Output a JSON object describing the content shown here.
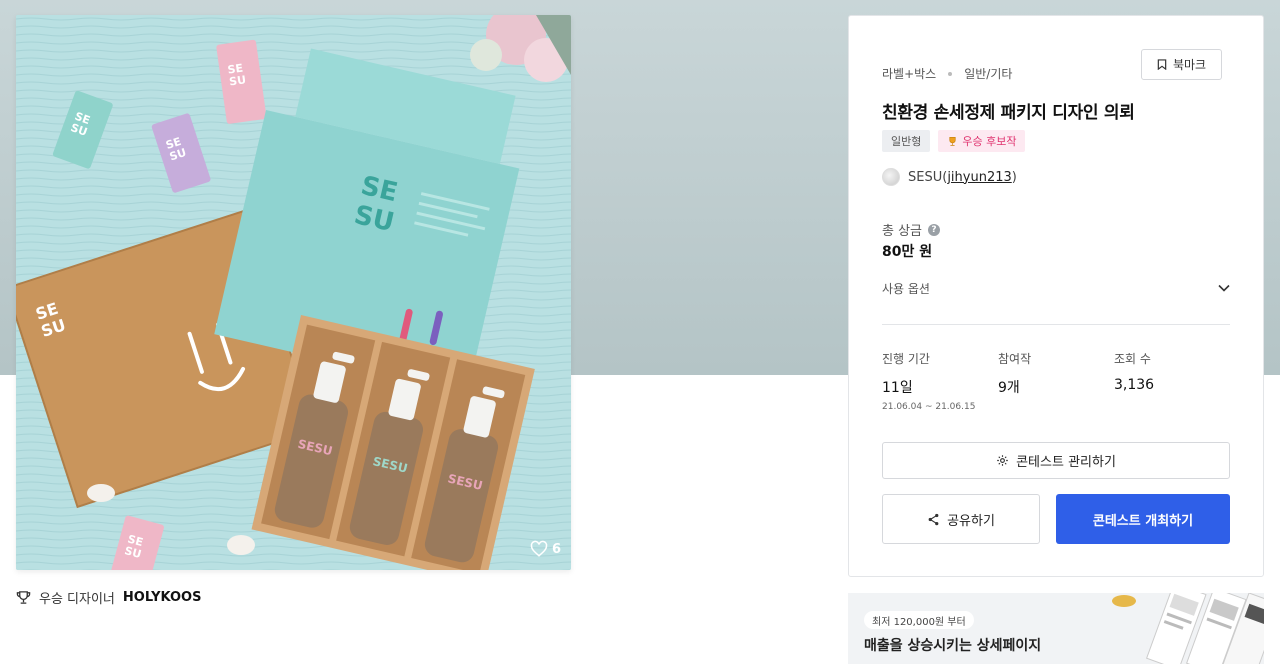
{
  "product": {
    "like_count": "6"
  },
  "designer": {
    "prefix": "우승 디자이너",
    "name": "HOLYKOOS"
  },
  "contest": {
    "category_main": "라벨+박스",
    "category_sub": "일반/기타",
    "bookmark_label": "북마크",
    "title": "친환경 손세정제 패키지 디자인 의뢰",
    "tag_type": "일반형",
    "tag_award": "우승 후보작",
    "owner_name": "SESU",
    "owner_handle": "jihyun213",
    "prize_label": "총 상금",
    "prize_value": "80만 원",
    "options_label": "사용 옵션",
    "stats": [
      {
        "label": "진행 기간",
        "value": "11일",
        "sub": "21.06.04 ~ 21.06.15"
      },
      {
        "label": "참여작",
        "value": "9개"
      },
      {
        "label": "조회 수",
        "value": "3,136"
      }
    ],
    "manage_label": "콘테스트 관리하기",
    "share_label": "공유하기",
    "host_label": "콘테스트 개최하기"
  },
  "ad": {
    "pill": "최저 120,000원 부터",
    "headline": "매출을 상승시키는 상세페이지"
  },
  "colors": {
    "primary": "#2f5fe8",
    "award": "#e0336f",
    "mint": "#8fd3d0",
    "kraft": "#c9955c"
  },
  "icons": [
    "heart-icon",
    "trophy-icon",
    "bookmark-icon",
    "help-icon",
    "chevron-down-icon",
    "gear-icon",
    "share-icon"
  ]
}
